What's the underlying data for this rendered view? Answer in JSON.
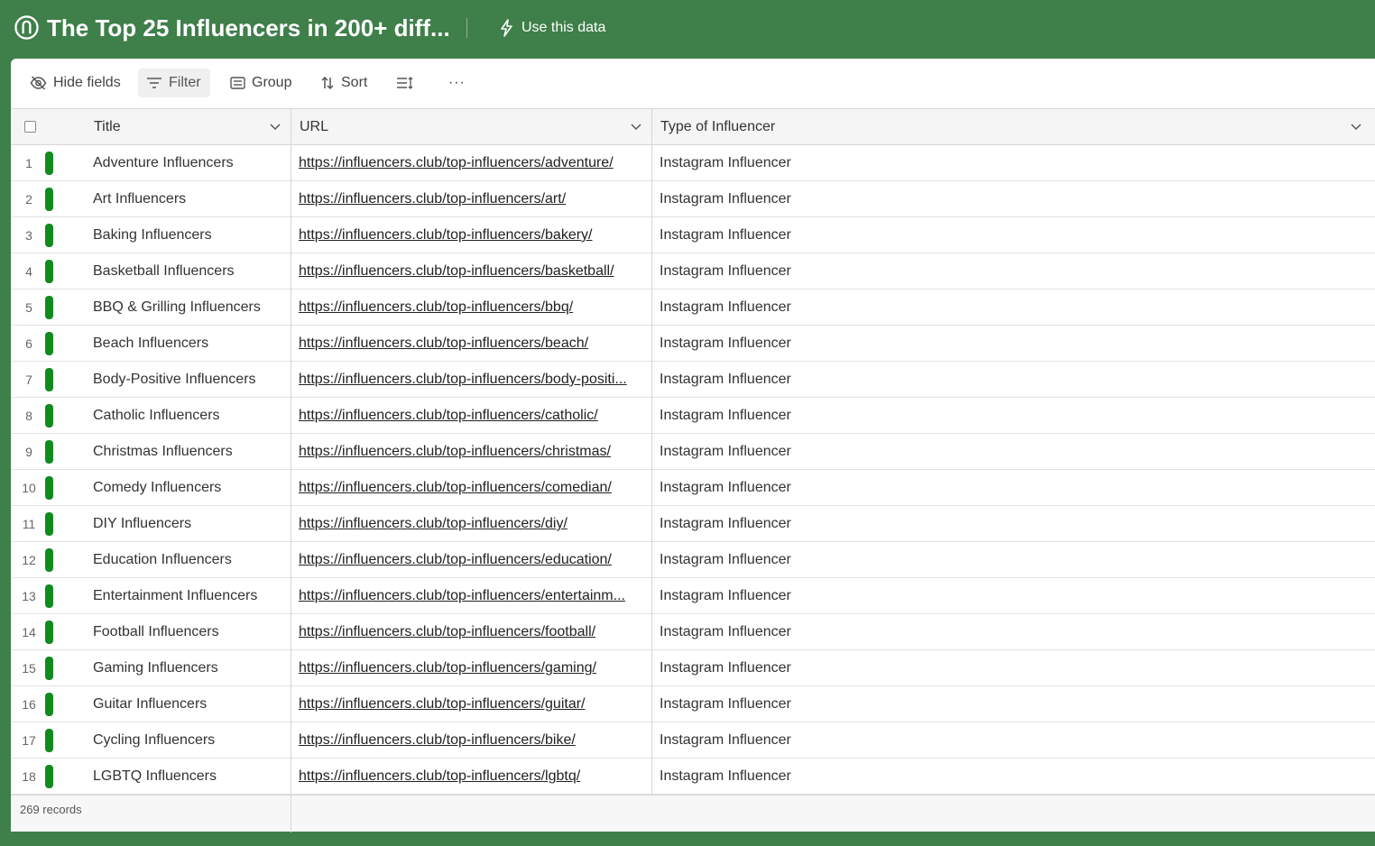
{
  "app": {
    "title": "The Top 25 Influencers in 200+ diff...",
    "use_data_label": "Use this data"
  },
  "colors": {
    "brand": "#3f7f4a",
    "row_bar": "#118a1e"
  },
  "toolbar": {
    "hide_fields": "Hide fields",
    "filter": "Filter",
    "group": "Group",
    "sort": "Sort",
    "row_height_icon": "row-height-icon",
    "more": "···"
  },
  "columns": {
    "title": "Title",
    "url": "URL",
    "type": "Type of Influencer"
  },
  "rows": [
    {
      "n": "1",
      "title": "Adventure Influencers",
      "url": "https://influencers.club/top-influencers/adventure/",
      "type": "Instagram Influencer"
    },
    {
      "n": "2",
      "title": "Art Influencers",
      "url": "https://influencers.club/top-influencers/art/",
      "type": "Instagram Influencer"
    },
    {
      "n": "3",
      "title": "Baking Influencers",
      "url": "https://influencers.club/top-influencers/bakery/",
      "type": "Instagram Influencer"
    },
    {
      "n": "4",
      "title": "Basketball Influencers",
      "url": "https://influencers.club/top-influencers/basketball/",
      "type": "Instagram Influencer"
    },
    {
      "n": "5",
      "title": "BBQ & Grilling Influencers",
      "url": "https://influencers.club/top-influencers/bbq/",
      "type": "Instagram Influencer"
    },
    {
      "n": "6",
      "title": "Beach Influencers",
      "url": "https://influencers.club/top-influencers/beach/",
      "type": "Instagram Influencer"
    },
    {
      "n": "7",
      "title": "Body-Positive Influencers",
      "url": "https://influencers.club/top-influencers/body-positi...",
      "type": "Instagram Influencer"
    },
    {
      "n": "8",
      "title": "Catholic Influencers",
      "url": "https://influencers.club/top-influencers/catholic/",
      "type": "Instagram Influencer"
    },
    {
      "n": "9",
      "title": "Christmas Influencers",
      "url": "https://influencers.club/top-influencers/christmas/",
      "type": "Instagram Influencer"
    },
    {
      "n": "10",
      "title": "Comedy Influencers",
      "url": "https://influencers.club/top-influencers/comedian/",
      "type": "Instagram Influencer"
    },
    {
      "n": "11",
      "title": "DIY Influencers",
      "url": "https://influencers.club/top-influencers/diy/",
      "type": "Instagram Influencer"
    },
    {
      "n": "12",
      "title": "Education Influencers",
      "url": "https://influencers.club/top-influencers/education/",
      "type": "Instagram Influencer"
    },
    {
      "n": "13",
      "title": "Entertainment Influencers",
      "url": "https://influencers.club/top-influencers/entertainm...",
      "type": "Instagram Influencer"
    },
    {
      "n": "14",
      "title": "Football Influencers",
      "url": "https://influencers.club/top-influencers/football/",
      "type": "Instagram Influencer"
    },
    {
      "n": "15",
      "title": "Gaming Influencers",
      "url": "https://influencers.club/top-influencers/gaming/",
      "type": "Instagram Influencer"
    },
    {
      "n": "16",
      "title": "Guitar Influencers",
      "url": "https://influencers.club/top-influencers/guitar/",
      "type": "Instagram Influencer"
    },
    {
      "n": "17",
      "title": "Cycling Influencers",
      "url": "https://influencers.club/top-influencers/bike/",
      "type": "Instagram Influencer"
    },
    {
      "n": "18",
      "title": "LGBTQ Influencers",
      "url": "https://influencers.club/top-influencers/lgbtq/",
      "type": "Instagram Influencer"
    }
  ],
  "footer": {
    "record_count": "269 records"
  }
}
